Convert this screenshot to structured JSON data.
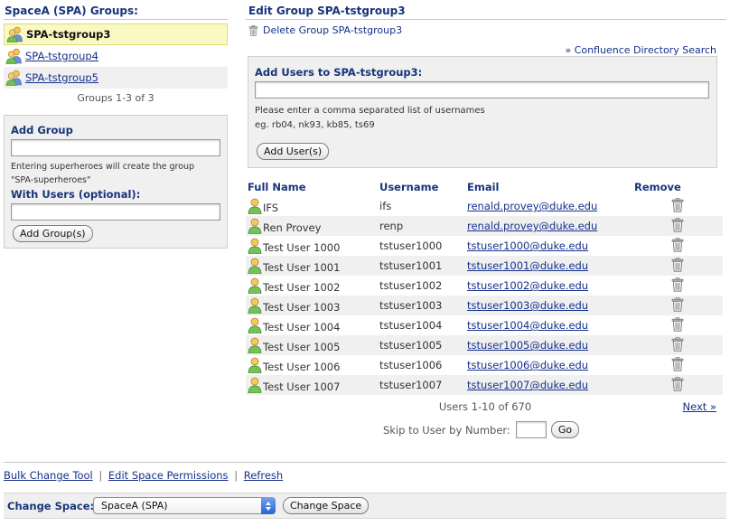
{
  "left": {
    "title": "SpaceA (SPA) Groups:",
    "groups": [
      {
        "name": "SPA-tstgroup3",
        "selected": true
      },
      {
        "name": "SPA-tstgroup4",
        "selected": false
      },
      {
        "name": "SPA-tstgroup5",
        "selected": false
      }
    ],
    "groups_count": "Groups 1-3 of 3",
    "add_group": {
      "label": "Add Group",
      "group_value": "",
      "hint_line1": "Entering superheroes will create the group",
      "hint_line2": "\"SPA-superheroes\"",
      "with_users_label": "With Users (optional):",
      "users_value": "",
      "button": "Add Group(s)"
    }
  },
  "right": {
    "title": "Edit Group SPA-tstgroup3",
    "delete_link": "Delete Group SPA-tstgroup3",
    "directory_link": "» Confluence Directory Search",
    "add_users": {
      "label": "Add Users to SPA-tstgroup3:",
      "value": "",
      "hint_line1": "Please enter a comma separated list of usernames",
      "hint_line2": "eg. rb04, nk93, kb85, ts69",
      "button": "Add User(s)"
    },
    "table": {
      "headers": {
        "full_name": "Full Name",
        "username": "Username",
        "email": "Email",
        "remove": "Remove"
      },
      "rows": [
        {
          "full_name": "IFS",
          "username": "ifs",
          "email": "renald.provey@duke.edu"
        },
        {
          "full_name": "Ren Provey",
          "username": "renp",
          "email": "renald.provey@duke.edu"
        },
        {
          "full_name": "Test User 1000",
          "username": "tstuser1000",
          "email": "tstuser1000@duke.edu"
        },
        {
          "full_name": "Test User 1001",
          "username": "tstuser1001",
          "email": "tstuser1001@duke.edu"
        },
        {
          "full_name": "Test User 1002",
          "username": "tstuser1002",
          "email": "tstuser1002@duke.edu"
        },
        {
          "full_name": "Test User 1003",
          "username": "tstuser1003",
          "email": "tstuser1003@duke.edu"
        },
        {
          "full_name": "Test User 1004",
          "username": "tstuser1004",
          "email": "tstuser1004@duke.edu"
        },
        {
          "full_name": "Test User 1005",
          "username": "tstuser1005",
          "email": "tstuser1005@duke.edu"
        },
        {
          "full_name": "Test User 1006",
          "username": "tstuser1006",
          "email": "tstuser1006@duke.edu"
        },
        {
          "full_name": "Test User 1007",
          "username": "tstuser1007",
          "email": "tstuser1007@duke.edu"
        }
      ]
    },
    "users_count": "Users 1-10 of 670",
    "next_link": "Next »",
    "skip_label": "Skip to User by Number:",
    "skip_value": "",
    "go_button": "Go"
  },
  "footer": {
    "links": [
      "Bulk Change Tool",
      "Edit Space Permissions",
      "Refresh"
    ],
    "separator": "|",
    "change_space_label": "Change Space:",
    "change_space_selected": "SpaceA (SPA)",
    "change_space_button": "Change Space"
  },
  "icons": {
    "group": "group-people-icon",
    "user": "user-person-icon",
    "trash": "trash-can-icon",
    "select_arrows": "select-up-down-arrows-icon"
  },
  "colors": {
    "heading": "#17357a",
    "link": "#15308a",
    "selected_row": "#fbf9c2",
    "alt_row": "#f0f0f0",
    "box_bg": "#f0f0f0",
    "select_arrow": "#2a62d2"
  }
}
